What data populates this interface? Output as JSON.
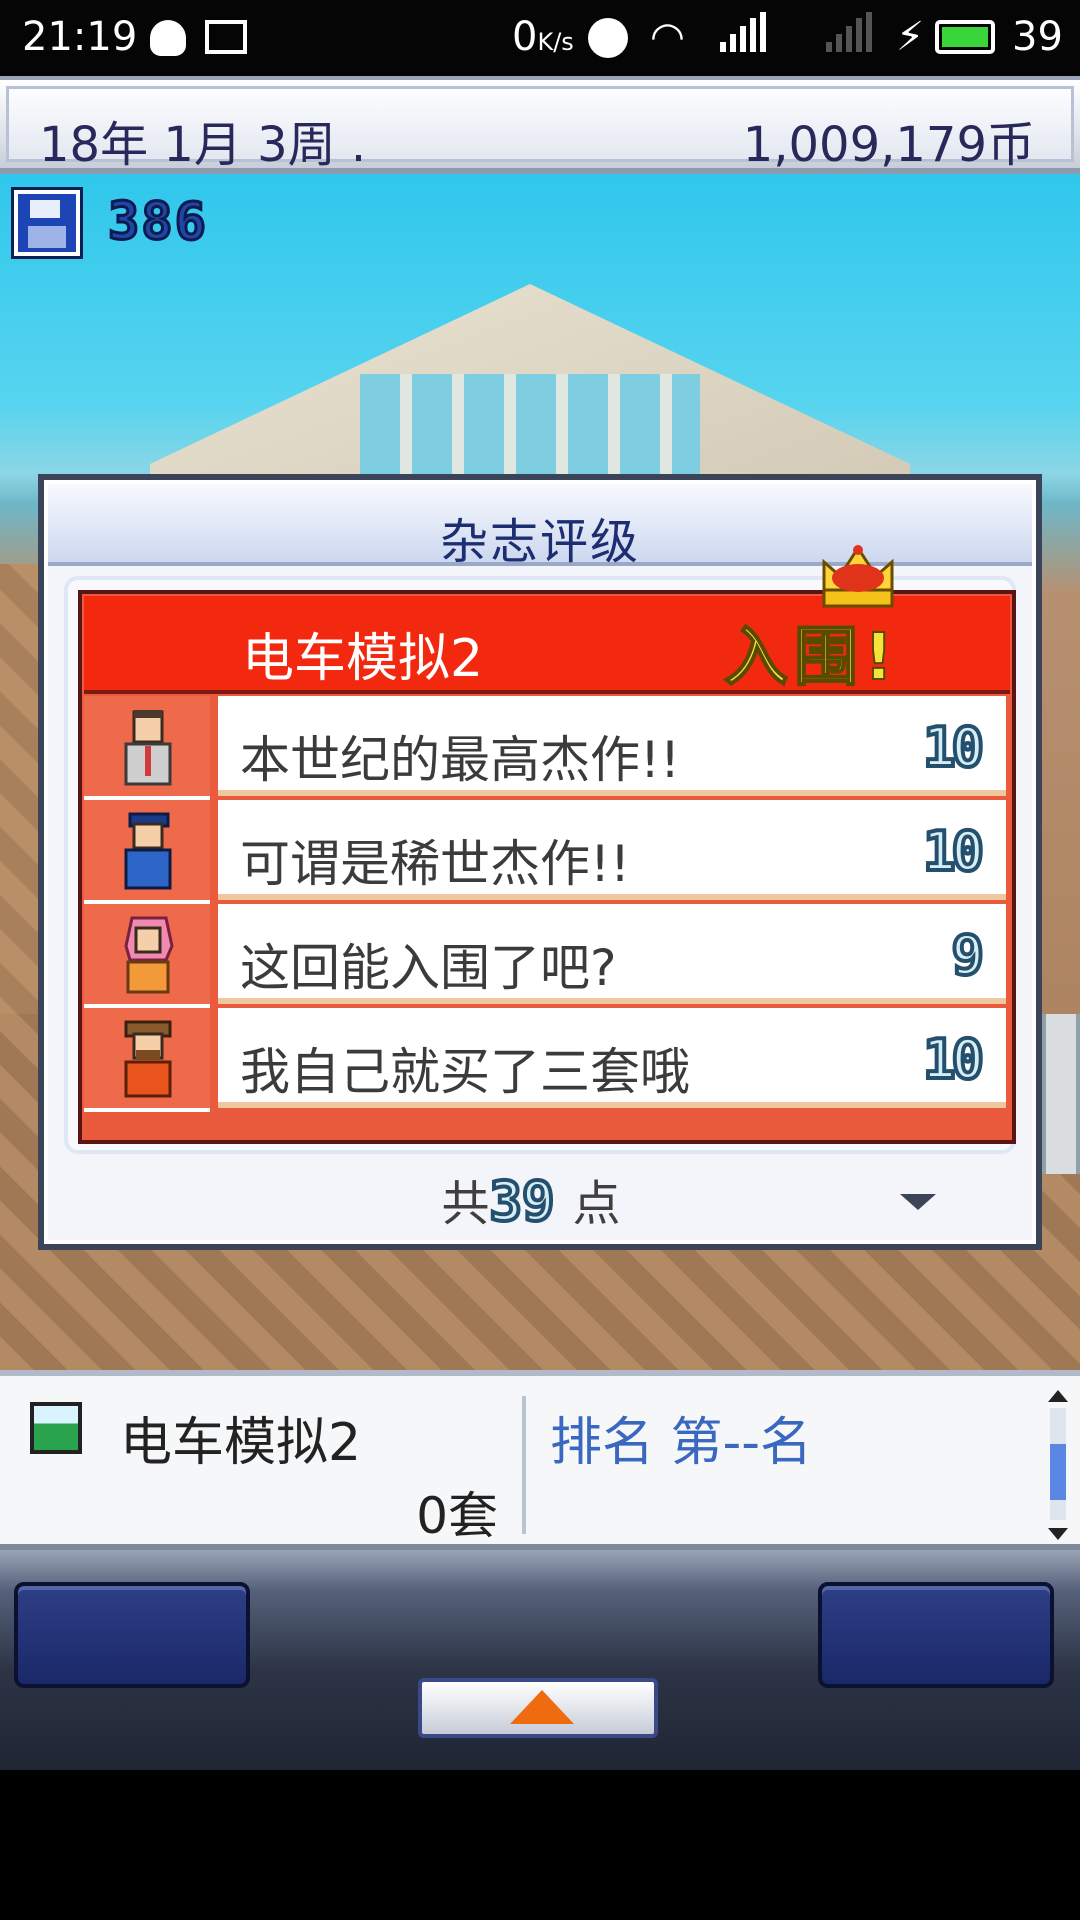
{
  "status_bar": {
    "time": "21:19",
    "net_speed_value": "0",
    "net_speed_unit": "K/s",
    "battery_level": "39",
    "icons": [
      "qq-icon",
      "image-icon",
      "alarm-icon",
      "wifi-icon",
      "signal-icon",
      "signal-e-icon",
      "charging-icon",
      "battery-icon"
    ]
  },
  "header": {
    "date": "18年 1月 3周 .",
    "money": "1,009,179币"
  },
  "scene": {
    "floppy_count": "386"
  },
  "review_dialog": {
    "title": "杂志评级",
    "game_name": "电车模拟2",
    "result": "入围!",
    "reviews": [
      {
        "reviewer_icon": "reviewer-1-avatar",
        "comment": "本世纪的最高杰作!!",
        "score": "10"
      },
      {
        "reviewer_icon": "reviewer-2-avatar",
        "comment": "可谓是稀世杰作!!",
        "score": "10"
      },
      {
        "reviewer_icon": "reviewer-3-avatar",
        "comment": "这回能入围了吧?",
        "score": "9"
      },
      {
        "reviewer_icon": "reviewer-4-avatar",
        "comment": "我自己就买了三套哦",
        "score": "10"
      }
    ],
    "total_label": "共",
    "total_value": "39",
    "total_unit": "点"
  },
  "info_panel": {
    "product_name": "电车模拟2",
    "sales": "0套",
    "rank": "排名 第--名"
  },
  "colors": {
    "card_red": "#f2290f",
    "avatar_bg": "#ee6a4a",
    "score_outline": "#24506e",
    "title_blue": "#1d2d72"
  }
}
